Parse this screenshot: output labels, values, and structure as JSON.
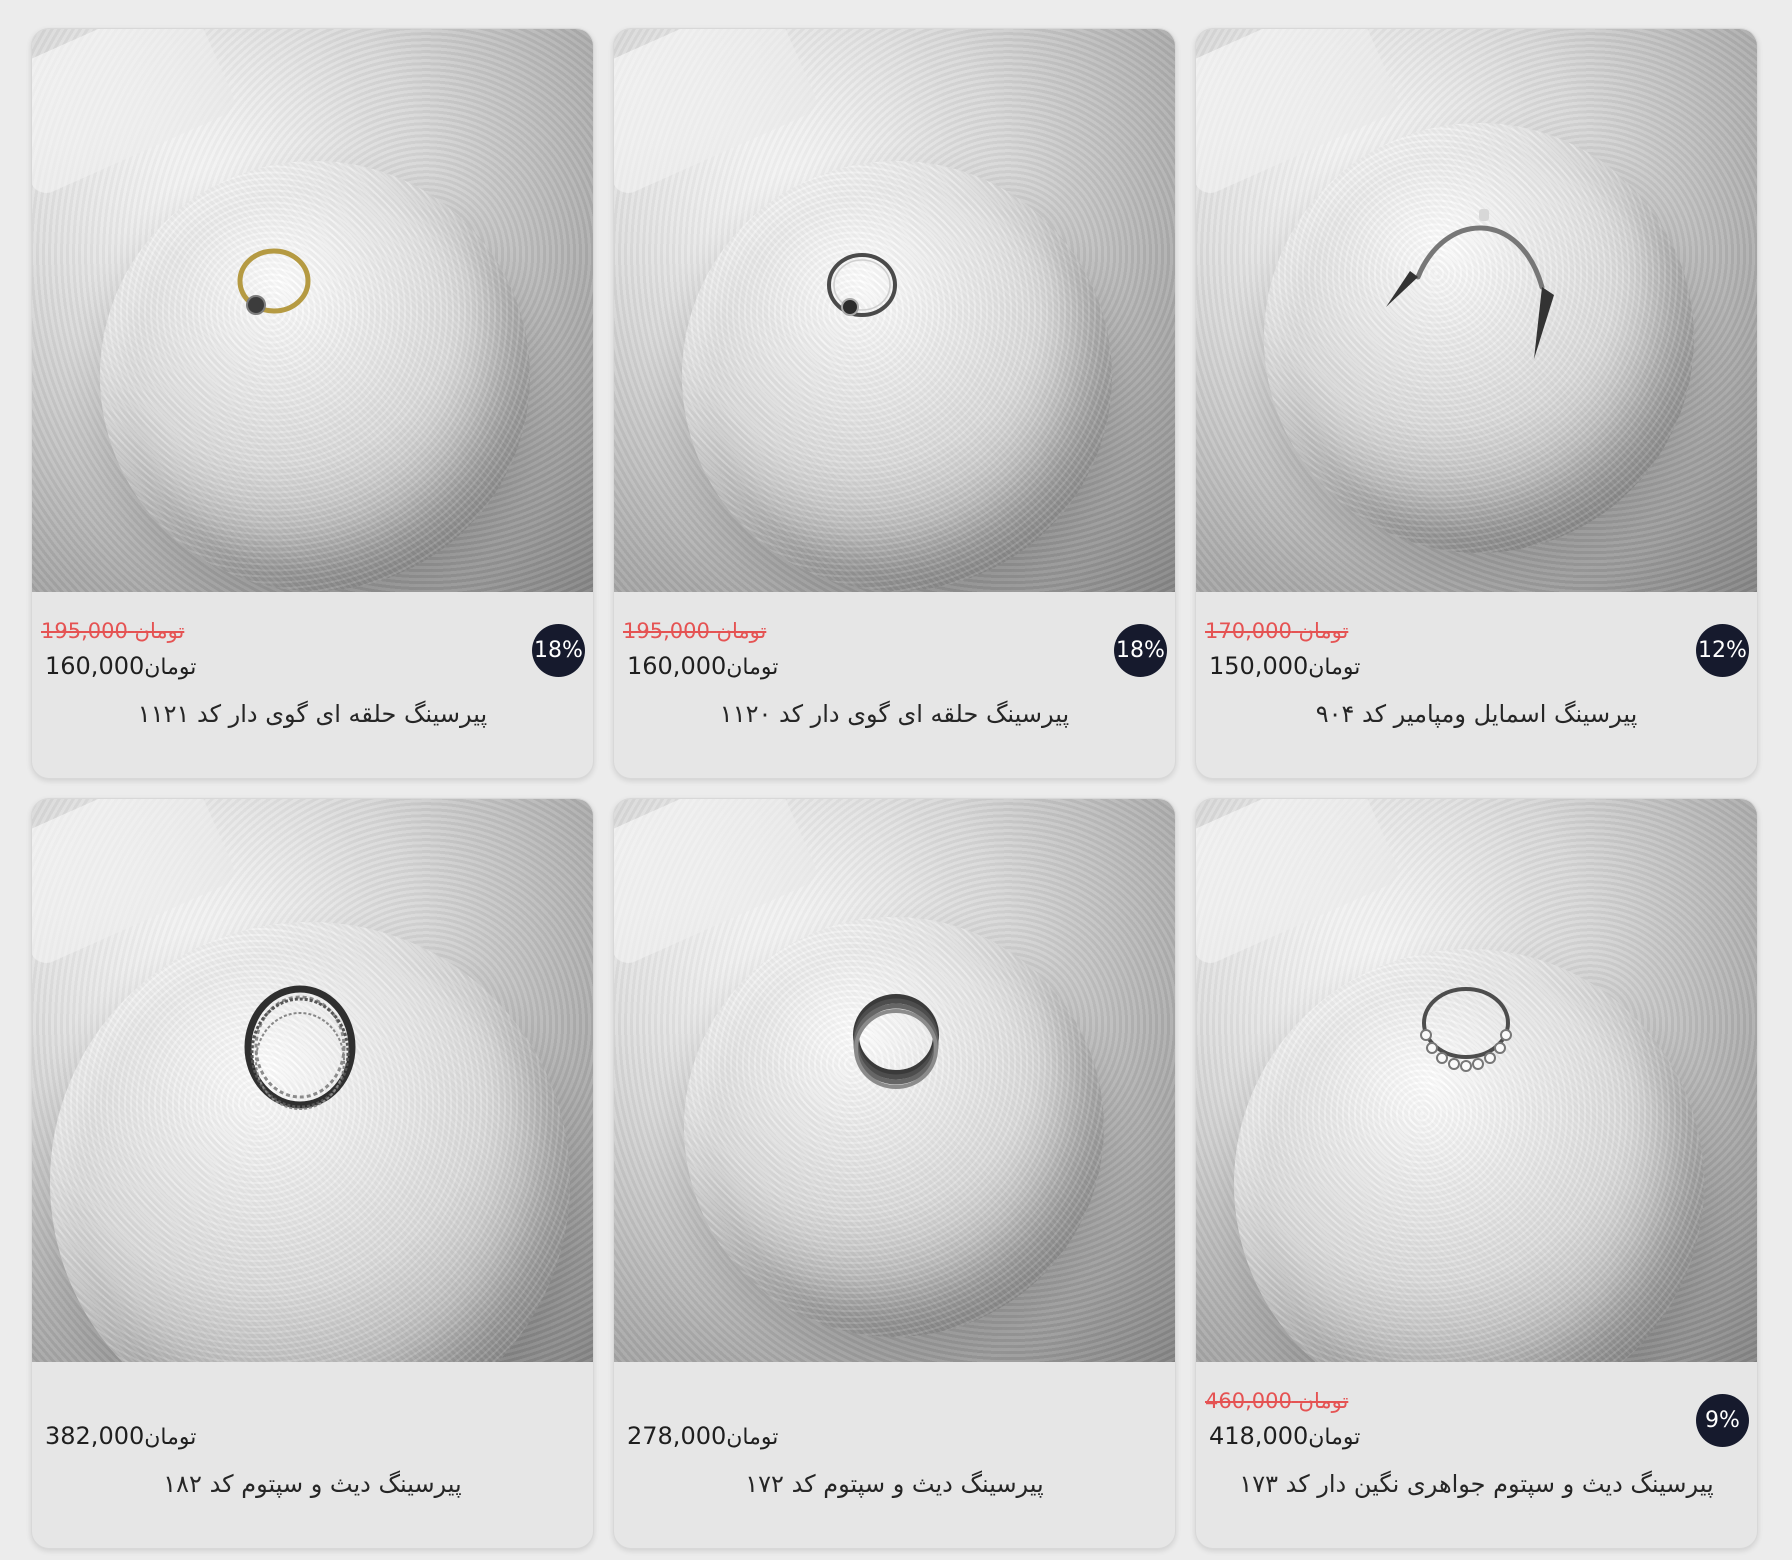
{
  "currency": "تومان",
  "products": [
    {
      "old_price": "195,000",
      "price": "160,000",
      "discount": "18%",
      "title": "پیرسینگ حلقه ای گوی دار کد ۱۱۲۱"
    },
    {
      "old_price": "195,000",
      "price": "160,000",
      "discount": "18%",
      "title": "پیرسینگ حلقه ای گوی دار کد ۱۱۲۰"
    },
    {
      "old_price": "170,000",
      "price": "150,000",
      "discount": "12%",
      "title": "پیرسینگ اسمایل ومپامیر کد ۹۰۴"
    },
    {
      "old_price": "",
      "price": "382,000",
      "discount": "",
      "title": "پیرسینگ دیث و سپتوم کد ۱۸۲"
    },
    {
      "old_price": "",
      "price": "278,000",
      "discount": "",
      "title": "پیرسینگ دیث و سپتوم کد ۱۷۲"
    },
    {
      "old_price": "460,000",
      "price": "418,000",
      "discount": "9%",
      "title": "پیرسینگ دیث و سپتوم جواهری نگین دار کد ۱۷۳"
    }
  ]
}
